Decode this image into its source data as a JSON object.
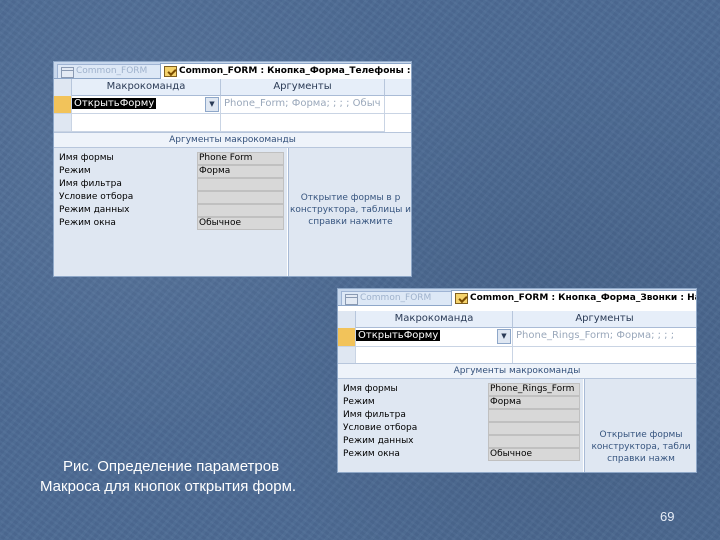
{
  "windows": [
    {
      "tab_inactive": "Common_FORM",
      "tab_active": "Common_FORM : Кнопка_Форма_Телефоны : На",
      "col_action": "Макрокоманда",
      "col_args": "Аргументы",
      "action_value": "ОткрытьФорму",
      "args_value": "Phone_Form; Форма; ; ; ; Обыч",
      "args_caption": "Аргументы макрокоманды",
      "props": [
        {
          "label": "Имя формы",
          "value": "Phone Form"
        },
        {
          "label": "Режим",
          "value": "Форма"
        },
        {
          "label": "Имя фильтра",
          "value": ""
        },
        {
          "label": "Условие отбора",
          "value": ""
        },
        {
          "label": "Режим данных",
          "value": ""
        },
        {
          "label": "Режим окна",
          "value": "Обычное"
        }
      ],
      "help": [
        "Открытие формы в р",
        "конструктора, таблицы и",
        "справки нажмите"
      ]
    },
    {
      "tab_inactive": "Common_FORM",
      "tab_active": "Common_FORM : Кнопка_Форма_Звонки : На",
      "col_action": "Макрокоманда",
      "col_args": "Аргументы",
      "action_value": "ОткрытьФорму",
      "args_value": "Phone_Rings_Form; Форма; ; ; ;",
      "args_caption": "Аргументы макрокоманды",
      "props": [
        {
          "label": "Имя формы",
          "value": "Phone_Rings_Form"
        },
        {
          "label": "Режим",
          "value": "Форма"
        },
        {
          "label": "Имя фильтра",
          "value": ""
        },
        {
          "label": "Условие отбора",
          "value": ""
        },
        {
          "label": "Режим данных",
          "value": ""
        },
        {
          "label": "Режим окна",
          "value": "Обычное"
        }
      ],
      "help": [
        "Открытие формы",
        "конструктора, табли",
        "справки нажм"
      ]
    }
  ],
  "caption_line1": "Рис. Определение параметров",
  "caption_line2": "Макроса для кнопок открытия форм.",
  "page_number": "69",
  "colors": {
    "background": "#4d6b94",
    "selected_row": "#f2c35a",
    "header": "#e6eef9"
  }
}
